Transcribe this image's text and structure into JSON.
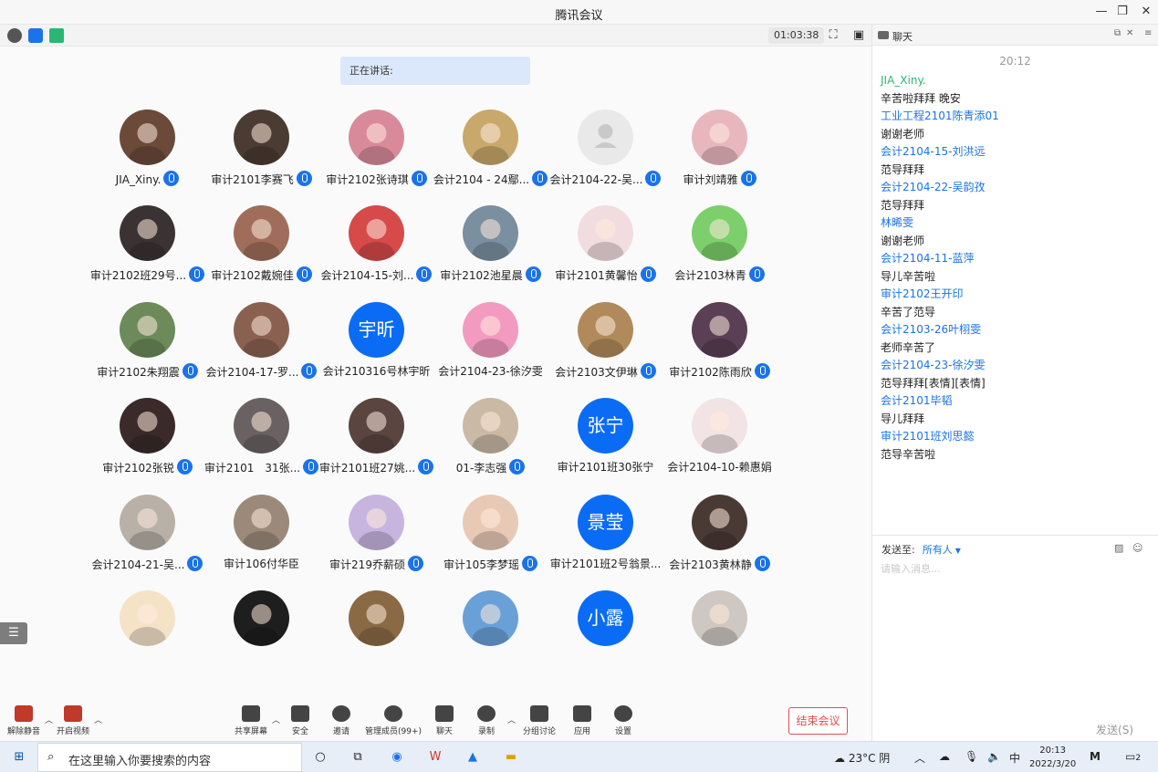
{
  "window": {
    "title": "腾讯会议",
    "min": "—",
    "restore": "❐",
    "close": "✕"
  },
  "meeting": {
    "timer": "01:03:38",
    "speaking": "正在讲话:"
  },
  "participants": [
    {
      "name": "JIA_Xiny.",
      "mic": true,
      "avatar": "photo",
      "color": "#6b4a3a"
    },
    {
      "name": "审计2101李赛飞",
      "mic": true,
      "avatar": "photo",
      "color": "#4a3b33"
    },
    {
      "name": "审计2102张诗琪",
      "mic": true,
      "avatar": "photo",
      "color": "#d98a9a"
    },
    {
      "name": "会计2104 - 24鄢...",
      "mic": true,
      "avatar": "photo",
      "color": "#c9a86b"
    },
    {
      "name": "会计2104-22-吴...",
      "mic": true,
      "avatar": "gray",
      "color": "#e9e9e9"
    },
    {
      "name": "审计刘靖雅",
      "mic": true,
      "avatar": "photo",
      "color": "#e8b7bd"
    },
    {
      "name": "审计2102班29号...",
      "mic": true,
      "avatar": "photo",
      "color": "#3b3333"
    },
    {
      "name": "审计2102戴婉佳",
      "mic": true,
      "avatar": "photo",
      "color": "#a06d5a"
    },
    {
      "name": "会计2104-15-刘...",
      "mic": true,
      "avatar": "photo",
      "color": "#d64a4a"
    },
    {
      "name": "审计2102池星晨",
      "mic": true,
      "avatar": "photo",
      "color": "#7a8fa0"
    },
    {
      "name": "审计2101黄馨怡",
      "mic": true,
      "avatar": "photo",
      "color": "#f1dde0"
    },
    {
      "name": "会计2103林青",
      "mic": true,
      "avatar": "photo",
      "color": "#7ccf6a"
    },
    {
      "name": "审计2102朱翔震",
      "mic": true,
      "avatar": "photo",
      "color": "#6c8a5a"
    },
    {
      "name": "会计2104-17-罗...",
      "mic": true,
      "avatar": "photo",
      "color": "#8a6150"
    },
    {
      "name": "会计210316号林宇昕",
      "mic": false,
      "avatar": "text",
      "text": "宇昕",
      "color": "#0a6cf5"
    },
    {
      "name": "会计2104-23-徐汐雯",
      "mic": false,
      "avatar": "photo",
      "color": "#f39ac0"
    },
    {
      "name": "会计2103文伊琳",
      "mic": true,
      "avatar": "photo",
      "color": "#b08a5a"
    },
    {
      "name": "审计2102陈雨欣",
      "mic": true,
      "avatar": "photo",
      "color": "#5a3f55"
    },
    {
      "name": "审计2102张锐",
      "mic": true,
      "avatar": "photo",
      "color": "#3a2a2a"
    },
    {
      "name": "审计2101　31张...",
      "mic": true,
      "avatar": "photo",
      "color": "#6a6262"
    },
    {
      "name": "审计2101班27姚...",
      "mic": true,
      "avatar": "photo",
      "color": "#5a4540"
    },
    {
      "name": "01-李志强",
      "mic": true,
      "avatar": "photo",
      "color": "#c9b9a5"
    },
    {
      "name": "审计2101班30张宁",
      "mic": false,
      "avatar": "text",
      "text": "张宁",
      "color": "#0a6cf5"
    },
    {
      "name": "会计2104-10-赖惠娟",
      "mic": false,
      "avatar": "photo",
      "color": "#f2e3e5"
    },
    {
      "name": "会计2104-21-吴...",
      "mic": true,
      "avatar": "photo",
      "color": "#b9b0a8"
    },
    {
      "name": "审计106付华臣",
      "mic": false,
      "avatar": "photo",
      "color": "#9b8a7a"
    },
    {
      "name": "审计219乔薪硕",
      "mic": true,
      "avatar": "photo",
      "color": "#c7b5e0"
    },
    {
      "name": "审计105李梦瑶",
      "mic": true,
      "avatar": "photo",
      "color": "#e8c9b5"
    },
    {
      "name": "审计2101班2号翁景...",
      "mic": false,
      "avatar": "text",
      "text": "景莹",
      "color": "#0a6cf5"
    },
    {
      "name": "会计2103黄林静",
      "mic": true,
      "avatar": "photo",
      "color": "#4a3a35"
    },
    {
      "name": "",
      "mic": false,
      "avatar": "photo",
      "color": "#f5e3c8"
    },
    {
      "name": "",
      "mic": false,
      "avatar": "photo",
      "color": "#1e1e1e"
    },
    {
      "name": "",
      "mic": false,
      "avatar": "photo",
      "color": "#8a6a45"
    },
    {
      "name": "",
      "mic": false,
      "avatar": "photo",
      "color": "#6aa0d8"
    },
    {
      "name": "",
      "mic": false,
      "avatar": "text",
      "text": "小露",
      "color": "#0a6cf5"
    },
    {
      "name": "",
      "mic": false,
      "avatar": "photo",
      "color": "#cfc7c2"
    }
  ],
  "toolbar": {
    "unmute": "解除静音",
    "video": "开启视频",
    "share": "共享屏幕",
    "security": "安全",
    "invite": "邀请",
    "members": "管理成员(99+)",
    "chat": "聊天",
    "record": "录制",
    "breakout": "分组讨论",
    "apps": "应用",
    "settings": "设置",
    "end": "结束会议"
  },
  "chat": {
    "title": "聊天",
    "time": "20:12",
    "messages": [
      {
        "sender": "JIA_Xiny.",
        "text": "辛苦啦拜拜 晚安"
      },
      {
        "sender": "工业工程2101陈青添01",
        "text": "谢谢老师"
      },
      {
        "sender": "会计2104-15-刘洪远",
        "text": "范导拜拜"
      },
      {
        "sender": "会计2104-22-吴韵孜",
        "text": "范导拜拜"
      },
      {
        "sender": "林晞雯",
        "text": "谢谢老师"
      },
      {
        "sender": "会计2104-11-蓝萍",
        "text": "导儿辛苦啦"
      },
      {
        "sender": "审计2102王开印",
        "text": "辛苦了范导"
      },
      {
        "sender": "会计2103-26叶栩雯",
        "text": "老师辛苦了"
      },
      {
        "sender": "会计2104-23-徐汐雯",
        "text": "范导拜拜[表情][表情]"
      },
      {
        "sender": "会计2101毕韬",
        "text": "导儿拜拜"
      },
      {
        "sender": "审计2101班刘思懿",
        "text": "范导辛苦啦"
      }
    ],
    "send_to_label": "发送至:",
    "send_to_value": "所有人",
    "input_placeholder": "请输入消息...",
    "send": "发送(S)"
  },
  "taskbar": {
    "search_placeholder": "在这里输入你要搜索的内容",
    "weather": "23°C 阴",
    "ime": "中",
    "time": "20:13",
    "date": "2022/3/20",
    "notif_count": "2"
  }
}
